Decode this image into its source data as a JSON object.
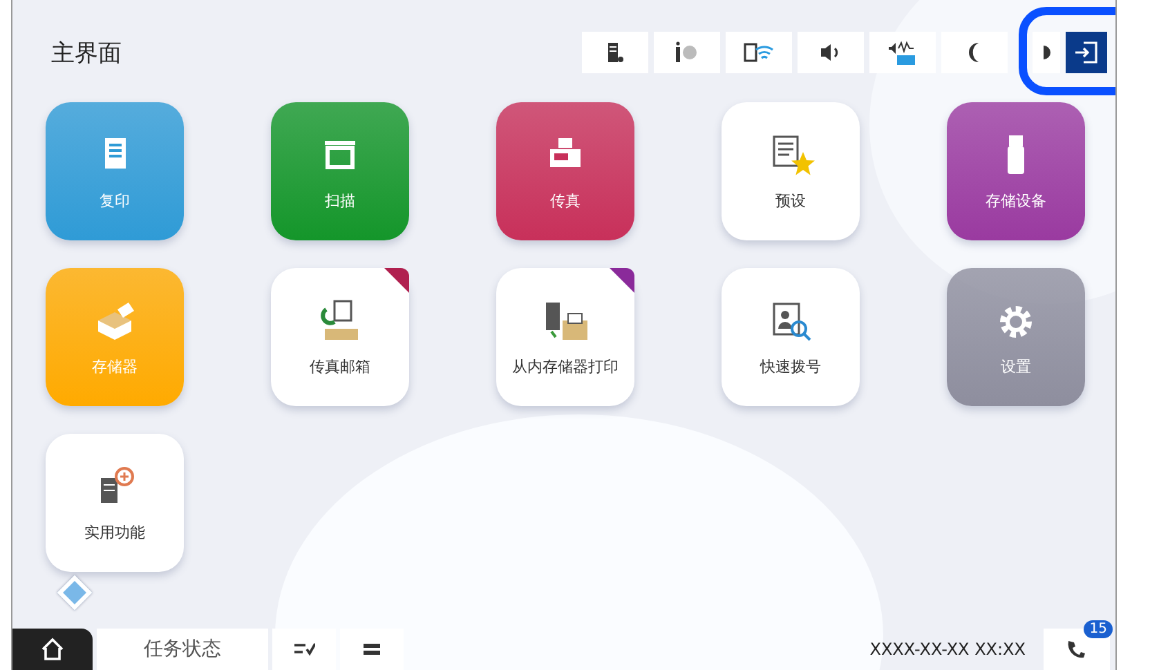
{
  "header": {
    "title": "主界面"
  },
  "tiles": [
    {
      "label": "复印",
      "kind": "color",
      "color": "#2f9bd6"
    },
    {
      "label": "扫描",
      "kind": "color",
      "color": "#14962a"
    },
    {
      "label": "传真",
      "kind": "color",
      "color": "#c8305a"
    },
    {
      "label": "预设",
      "kind": "white"
    },
    {
      "label": "存储设备",
      "kind": "color",
      "color": "#9a3aa0"
    },
    {
      "label": "存储器",
      "kind": "color",
      "color": "#ffaa00"
    },
    {
      "label": "传真邮箱",
      "kind": "white",
      "corner": {
        "color": "#b0204f"
      }
    },
    {
      "label": "从内存储器打印",
      "kind": "white",
      "corner": {
        "color": "#8a2a9a"
      }
    },
    {
      "label": "快速拨号",
      "kind": "white"
    },
    {
      "label": "设置",
      "kind": "color",
      "color": "#8e8e9e"
    },
    {
      "label": "实用功能",
      "kind": "white"
    }
  ],
  "bottom_bar": {
    "job_status": "任务状态",
    "datetime": "XXXX-XX-XX XX:XX",
    "fax_badge": "15"
  }
}
